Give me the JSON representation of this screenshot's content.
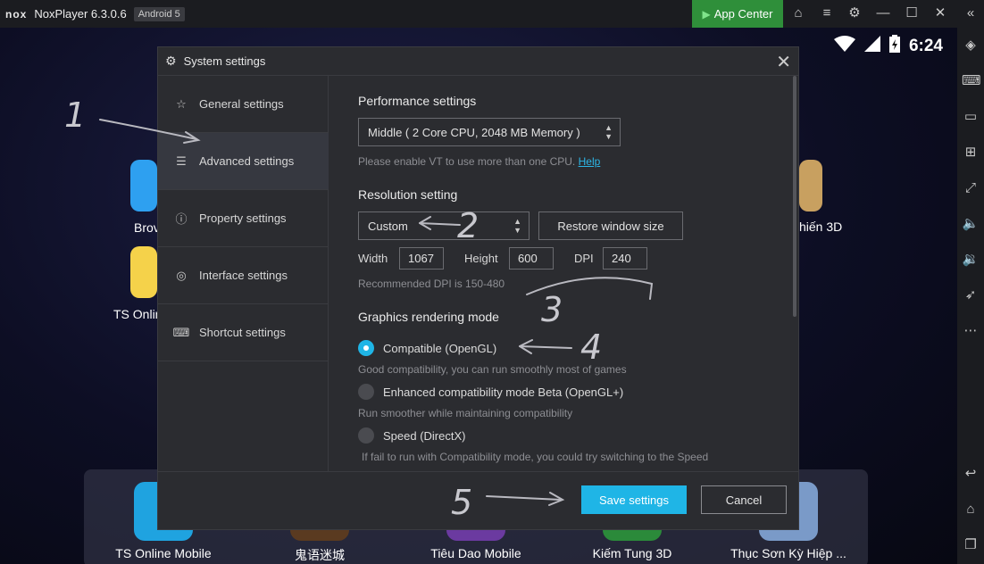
{
  "titlebar": {
    "logo": "nox",
    "app_title": "NoxPlayer 6.3.0.6",
    "android_badge": "Android 5",
    "app_center": "App Center"
  },
  "status": {
    "time": "6:24"
  },
  "home_apps": {
    "side_left_1": "Brov",
    "side_left_2": "TS Onlin",
    "side_right_1": "hiến 3D"
  },
  "dock_apps": [
    {
      "label": "TS Online Mobile",
      "color": "#1fa3e0"
    },
    {
      "label": "鬼语迷城",
      "color": "#5a3a20"
    },
    {
      "label": "Tiêu Dao Mobile",
      "color": "#6b3aa0"
    },
    {
      "label": "Kiếm Tung 3D",
      "color": "#2b8a3a"
    },
    {
      "label": "Thục Sơn Kỳ Hiệp ...",
      "color": "#7a9ac8"
    }
  ],
  "dialog": {
    "title": "System settings",
    "nav": [
      {
        "label": "General settings",
        "icon": "star-icon"
      },
      {
        "label": "Advanced settings",
        "icon": "sliders-icon"
      },
      {
        "label": "Property settings",
        "icon": "info-icon"
      },
      {
        "label": "Interface settings",
        "icon": "palette-icon"
      },
      {
        "label": "Shortcut settings",
        "icon": "keyboard-icon"
      }
    ],
    "performance": {
      "heading": "Performance settings",
      "value": "Middle ( 2 Core CPU, 2048 MB Memory )",
      "hint": "Please enable VT to use more than one CPU.",
      "help": "Help"
    },
    "resolution": {
      "heading": "Resolution setting",
      "value": "Custom",
      "restore_button": "Restore window size",
      "width_label": "Width",
      "width_value": "1067",
      "height_label": "Height",
      "height_value": "600",
      "dpi_label": "DPI",
      "dpi_value": "240",
      "hint": "Recommended DPI is 150-480"
    },
    "graphics": {
      "heading": "Graphics rendering mode",
      "options": [
        {
          "label": "Compatible (OpenGL)",
          "desc": "Good compatibility, you can run smoothly most of games",
          "selected": true
        },
        {
          "label": "Enhanced compatibility mode Beta (OpenGL+)",
          "desc": "Run smoother while maintaining compatibility",
          "selected": false
        },
        {
          "label": "Speed (DirectX)",
          "desc": "If fail to run with Compatibility mode, you could try switching to the Speed",
          "selected": false
        }
      ]
    },
    "footer": {
      "save": "Save settings",
      "cancel": "Cancel"
    }
  },
  "annotations": [
    "1",
    "2",
    "3",
    "4",
    "5"
  ],
  "colors": {
    "accent": "#1fb5e6",
    "app_center": "#2f8f3a"
  }
}
